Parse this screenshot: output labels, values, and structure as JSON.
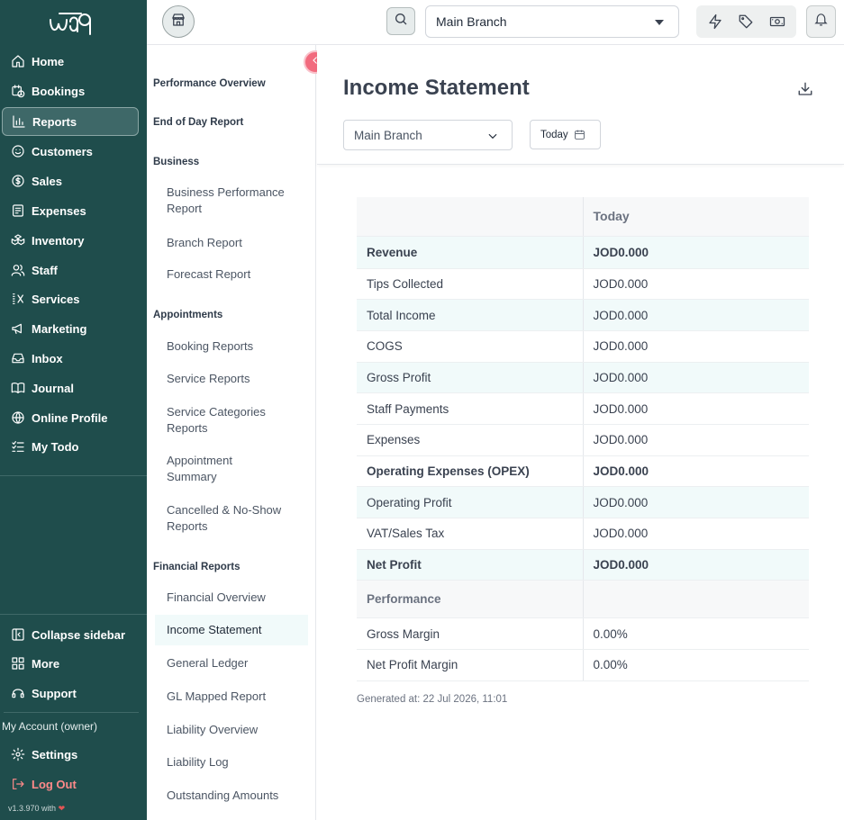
{
  "app": {
    "logo_text": "waq",
    "version": "v1.3.970 with"
  },
  "sidebar": {
    "items": [
      {
        "label": "Home",
        "icon": "home-icon"
      },
      {
        "label": "Bookings",
        "icon": "calendar-clock-icon"
      },
      {
        "label": "Reports",
        "icon": "bar-chart-icon",
        "active": true
      },
      {
        "label": "Customers",
        "icon": "smile-icon"
      },
      {
        "label": "Sales",
        "icon": "dollar-circle-icon"
      },
      {
        "label": "Expenses",
        "icon": "receipt-icon"
      },
      {
        "label": "Inventory",
        "icon": "boxes-icon"
      },
      {
        "label": "Staff",
        "icon": "users-icon"
      },
      {
        "label": "Services",
        "icon": "services-icon"
      },
      {
        "label": "Marketing",
        "icon": "megaphone-icon"
      },
      {
        "label": "Inbox",
        "icon": "inbox-icon"
      },
      {
        "label": "Journal",
        "icon": "book-icon"
      },
      {
        "label": "Online Profile",
        "icon": "globe-icon"
      },
      {
        "label": "My Todo",
        "icon": "checklist-icon"
      }
    ],
    "bottom": {
      "collapse": "Collapse sidebar",
      "more": "More",
      "support": "Support",
      "my_account": "My Account  (owner)",
      "settings": "Settings",
      "logout": "Log Out"
    }
  },
  "topbar": {
    "branch": "Main Branch"
  },
  "subnav": {
    "performance_overview": "Performance Overview",
    "end_of_day": "End of Day Report",
    "business_head": "Business",
    "business_items": [
      "Business Performance Report",
      "Branch Report",
      "Forecast Report"
    ],
    "appointments_head": "Appointments",
    "appointments_items": [
      "Booking Reports",
      "Service Reports",
      "Service Categories Reports",
      "Appointment Summary",
      "Cancelled & No-Show Reports"
    ],
    "financial_head": "Financial Reports",
    "financial_items": [
      "Financial Overview",
      "Income Statement",
      "General Ledger",
      "GL Mapped Report",
      "Liability Overview",
      "Liability Log",
      "Outstanding Amounts"
    ]
  },
  "main": {
    "title": "Income Statement",
    "filter_branch": "Main Branch",
    "filter_date": "Today",
    "table": {
      "header": [
        "",
        "Today"
      ],
      "rows": [
        {
          "label": "Revenue",
          "value": "JOD0.000"
        },
        {
          "label": "Tips Collected",
          "value": "JOD0.000"
        },
        {
          "label": "Total Income",
          "value": "JOD0.000"
        },
        {
          "label": "COGS",
          "value": "JOD0.000"
        },
        {
          "label": "Gross Profit",
          "value": "JOD0.000"
        },
        {
          "label": "Staff Payments",
          "value": "JOD0.000"
        },
        {
          "label": "Expenses",
          "value": "JOD0.000"
        },
        {
          "label": "Operating Expenses (OPEX)",
          "value": "JOD0.000"
        },
        {
          "label": "Operating Profit",
          "value": "JOD0.000"
        },
        {
          "label": "VAT/Sales Tax",
          "value": "JOD0.000"
        },
        {
          "label": "Net Profit",
          "value": "JOD0.000"
        },
        {
          "label": "Performance",
          "value": ""
        },
        {
          "label": "Gross Margin",
          "value": "0.00%"
        },
        {
          "label": "Net Profit Margin",
          "value": "0.00%"
        }
      ]
    },
    "generated": "Generated at: 22 Jul 2026, 11:01"
  },
  "colors": {
    "sidebar_bg": "#1f4d4c",
    "accent_pink": "#f26b7e",
    "row_highlight": "#f1fafa"
  }
}
